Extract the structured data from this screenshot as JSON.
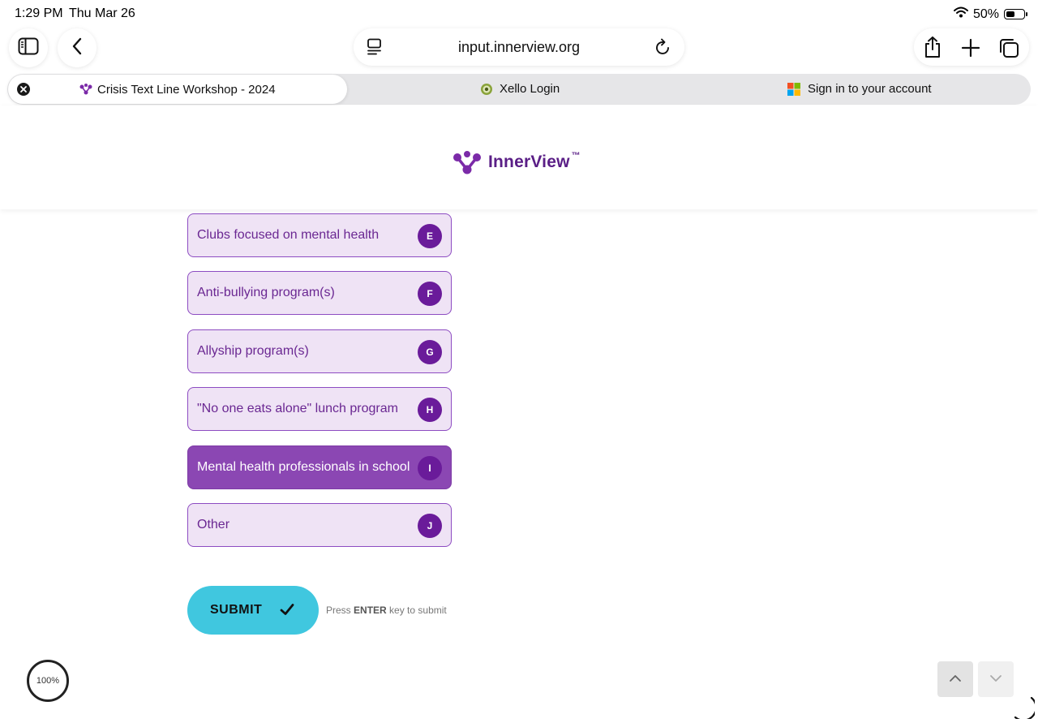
{
  "status_bar": {
    "time": "1:29 PM",
    "date": "Thu Mar 26",
    "battery_text": "50%",
    "battery_level": 0.5
  },
  "toolbar": {
    "url": "input.innerview.org"
  },
  "tabs": [
    {
      "title": "Crisis Text Line Workshop - 2024",
      "active": true
    },
    {
      "title": "Xello Login",
      "active": false
    },
    {
      "title": "Sign in to your account",
      "active": false
    }
  ],
  "brand": {
    "name": "InnerView",
    "trademark": "™",
    "color": "#5a1e86"
  },
  "options": [
    {
      "label": "Clubs focused on mental health",
      "key": "E",
      "selected": false
    },
    {
      "label": "Anti-bullying program(s)",
      "key": "F",
      "selected": false
    },
    {
      "label": "Allyship program(s)",
      "key": "G",
      "selected": false
    },
    {
      "label": "\"No one eats alone\" lunch program",
      "key": "H",
      "selected": false
    },
    {
      "label": "Mental health professionals in school",
      "key": "I",
      "selected": true
    },
    {
      "label": "Other",
      "key": "J",
      "selected": false
    }
  ],
  "submit": {
    "label": "SUBMIT",
    "hint_prefix": "Press",
    "hint_key": "ENTER",
    "hint_suffix": "key to submit"
  },
  "progress": {
    "text": "100%"
  },
  "colors": {
    "option_bg": "#efe3f5",
    "option_selected_bg": "#8b47b3",
    "key_badge": "#6a1b9a",
    "submit_bg": "#40c7df"
  }
}
